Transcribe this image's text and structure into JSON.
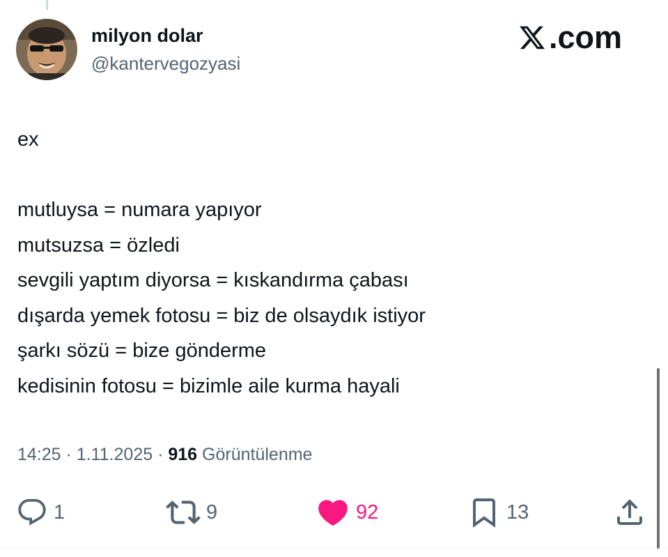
{
  "author": {
    "display_name": "milyon dolar",
    "handle": "@kantervegozyasi"
  },
  "brand": {
    "logo_icon": "x-logo-icon",
    "domain": ".com"
  },
  "tweet": {
    "lines": [
      "ex",
      "",
      "mutluysa = numara yapıyor",
      "mutsuzsa = özledi",
      "sevgili yaptım diyorsa = kıskandırma çabası",
      "dışarda yemek fotosu = biz de olsaydık istiyor",
      "şarkı sözü = bize gönderme",
      "kedisinin fotosu = bizimle aile kurma hayali"
    ]
  },
  "meta": {
    "time": "14:25",
    "sep1": " · ",
    "date": "1.11.2025",
    "sep2": " · ",
    "views_count": "916",
    "views_label": " Görüntülenme"
  },
  "actions": {
    "reply": {
      "icon": "reply-icon",
      "count": "1"
    },
    "repost": {
      "icon": "repost-icon",
      "count": "9"
    },
    "like": {
      "icon": "heart-filled-icon",
      "count": "92",
      "liked": true,
      "color": "#f91880"
    },
    "bookmark": {
      "icon": "bookmark-icon",
      "count": "13"
    },
    "share": {
      "icon": "share-icon"
    }
  },
  "colors": {
    "text": "#0f1419",
    "secondary": "#536471",
    "like": "#f91880"
  }
}
